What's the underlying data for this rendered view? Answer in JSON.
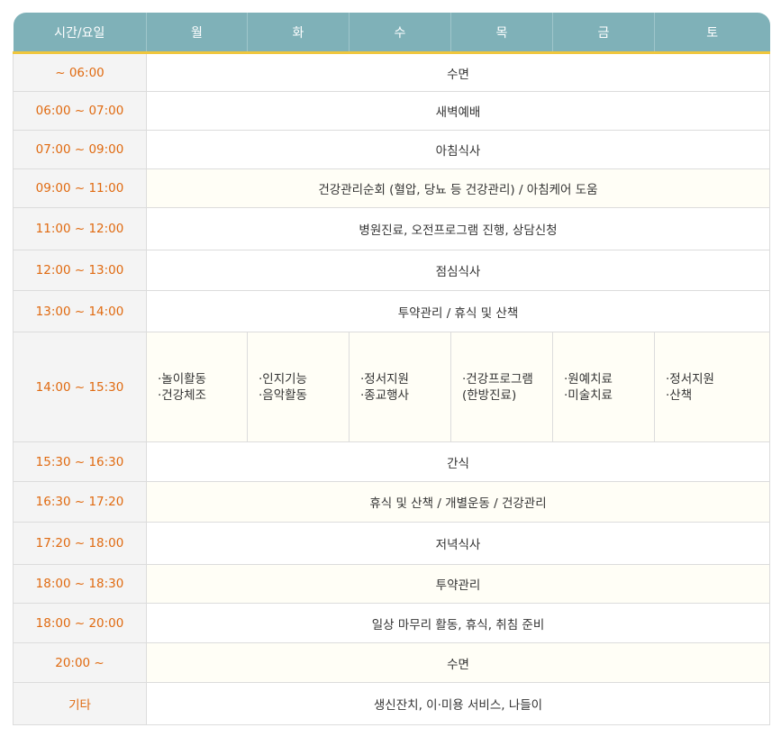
{
  "header": {
    "time": "시간/요일",
    "days": [
      "월",
      "화",
      "수",
      "목",
      "금",
      "토"
    ]
  },
  "rows": [
    {
      "time": "~ 06:00",
      "activity": "수면"
    },
    {
      "time": "06:00 ~ 07:00",
      "activity": "새벽예배"
    },
    {
      "time": "07:00 ~ 09:00",
      "activity": "아침식사"
    },
    {
      "time": "09:00 ~ 11:00",
      "activity": "건강관리순회 (혈압, 당뇨 등 건강관리) / 아침케어 도움"
    },
    {
      "time": "11:00 ~ 12:00",
      "activity": "병원진료, 오전프로그램 진행, 상담신청"
    },
    {
      "time": "12:00 ~ 13:00",
      "activity": "점심식사"
    },
    {
      "time": "13:00 ~ 14:00",
      "activity": "투약관리 / 휴식 및 산책"
    },
    {
      "time": "14:00 ~ 15:30",
      "daily": [
        [
          "·놀이활동",
          "·건강체조"
        ],
        [
          "·인지기능",
          "·음악활동"
        ],
        [
          "·정서지원",
          "·종교행사"
        ],
        [
          "·건강프로그램",
          "(한방진료)"
        ],
        [
          "·원예치료",
          "·미술치료"
        ],
        [
          "·정서지원",
          "·산책"
        ]
      ]
    },
    {
      "time": "15:30 ~ 16:30",
      "activity": "간식"
    },
    {
      "time": "16:30 ~ 17:20",
      "activity": "휴식 및 산책 / 개별운동 / 건강관리"
    },
    {
      "time": "17:20 ~ 18:00",
      "activity": "저녁식사"
    },
    {
      "time": "18:00 ~ 18:30",
      "activity": "투약관리"
    },
    {
      "time": "18:00 ~ 20:00",
      "activity": "일상 마무리 활동, 휴식, 취침 준비"
    },
    {
      "time": "20:00 ~",
      "activity": "수면"
    },
    {
      "time": "기타",
      "activity": "생신잔치, 이·미용 서비스, 나들이"
    }
  ],
  "colors": {
    "header": "#7fb1b8",
    "header_underline": "#f0c63c",
    "time_text": "#e06a10"
  }
}
